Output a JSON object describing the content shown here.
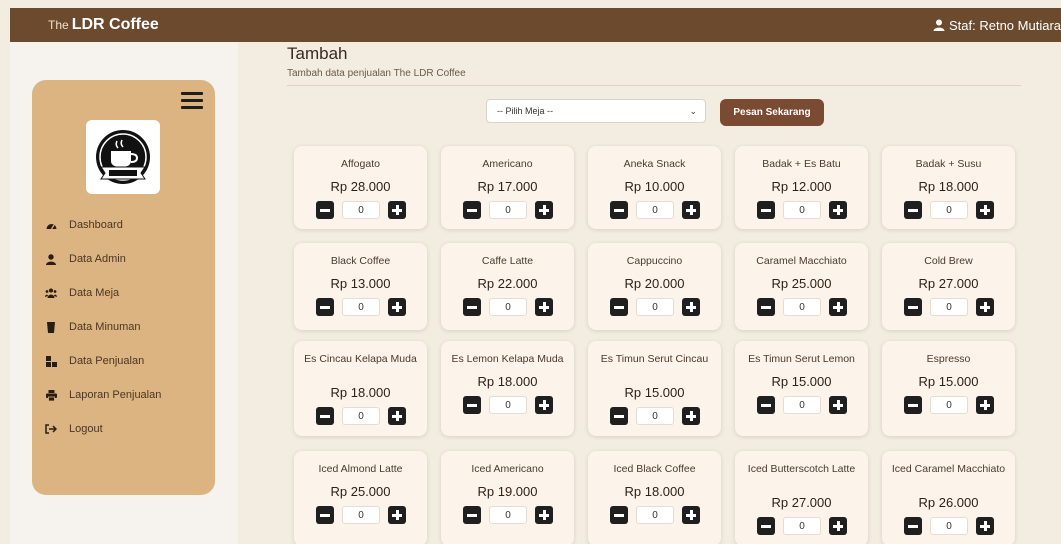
{
  "header": {
    "brand_prefix": "The",
    "brand_name": "LDR Coffee",
    "user_label": "Staf: Retno Mutiara"
  },
  "sidebar": {
    "items": [
      {
        "label": "Dashboard",
        "icon": "dashboard-icon"
      },
      {
        "label": "Data Admin",
        "icon": "user-icon"
      },
      {
        "label": "Data Meja",
        "icon": "users-icon"
      },
      {
        "label": "Data Minuman",
        "icon": "cup-icon"
      },
      {
        "label": "Data Penjualan",
        "icon": "boxes-icon"
      },
      {
        "label": "Laporan Penjualan",
        "icon": "printer-icon"
      },
      {
        "label": "Logout",
        "icon": "logout-icon"
      }
    ]
  },
  "page": {
    "title": "Tambah",
    "subtitle": "Tambah data penjualan The LDR Coffee"
  },
  "order": {
    "table_select": "-- Pilih Meja --",
    "submit_label": "Pesan Sekarang"
  },
  "products": [
    {
      "name": "Affogato",
      "price": "Rp 28.000",
      "qty": "0"
    },
    {
      "name": "Americano",
      "price": "Rp 17.000",
      "qty": "0"
    },
    {
      "name": "Aneka Snack",
      "price": "Rp 10.000",
      "qty": "0"
    },
    {
      "name": "Badak + Es Batu",
      "price": "Rp 12.000",
      "qty": "0"
    },
    {
      "name": "Badak + Susu",
      "price": "Rp 18.000",
      "qty": "0"
    },
    {
      "name": "Black Coffee",
      "price": "Rp 13.000",
      "qty": "0"
    },
    {
      "name": "Caffe Latte",
      "price": "Rp 22.000",
      "qty": "0"
    },
    {
      "name": "Cappuccino",
      "price": "Rp 20.000",
      "qty": "0"
    },
    {
      "name": "Caramel Macchiato",
      "price": "Rp 25.000",
      "qty": "0"
    },
    {
      "name": "Cold Brew",
      "price": "Rp 27.000",
      "qty": "0"
    },
    {
      "name": "Es Cincau Kelapa Muda",
      "price": "Rp 18.000",
      "qty": "0"
    },
    {
      "name": "Es Lemon Kelapa Muda",
      "price": "Rp 18.000",
      "qty": "0"
    },
    {
      "name": "Es Timun Serut Cincau",
      "price": "Rp 15.000",
      "qty": "0"
    },
    {
      "name": "Es Timun Serut Lemon",
      "price": "Rp 15.000",
      "qty": "0"
    },
    {
      "name": "Espresso",
      "price": "Rp 15.000",
      "qty": "0"
    },
    {
      "name": "Iced Almond Latte",
      "price": "Rp 25.000",
      "qty": "0"
    },
    {
      "name": "Iced Americano",
      "price": "Rp 19.000",
      "qty": "0"
    },
    {
      "name": "Iced Black Coffee",
      "price": "Rp 18.000",
      "qty": "0"
    },
    {
      "name": "Iced Butterscotch Latte",
      "price": "Rp 27.000",
      "qty": "0"
    },
    {
      "name": "Iced Caramel Macchiato",
      "price": "Rp 26.000",
      "qty": "0"
    }
  ],
  "colors": {
    "topbar": "#6b4a2e",
    "sidebar": "#dcb482",
    "accent": "#7b4a32",
    "card": "#fcf3ea"
  }
}
